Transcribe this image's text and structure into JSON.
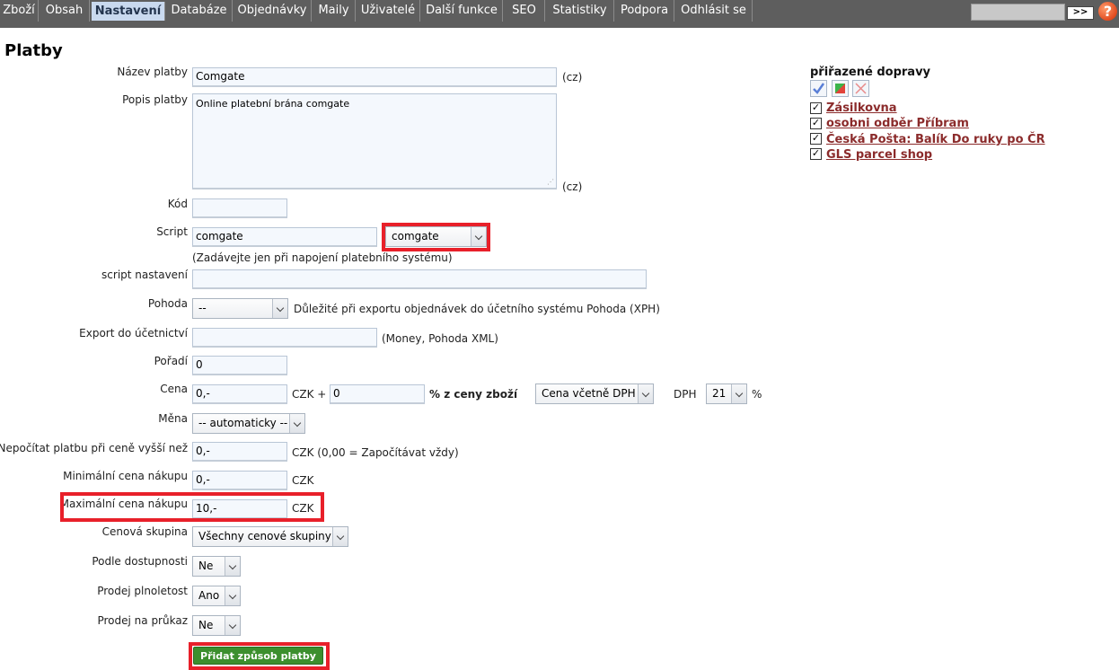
{
  "nav": {
    "items": [
      "Zboží",
      "Obsah",
      "Nastavení",
      "Databáze",
      "Objednávky",
      "Maily",
      "Uživatelé",
      "Další funkce",
      "SEO",
      "Statistiky",
      "Podpora",
      "Odhlásit se"
    ],
    "active": "Nastavení",
    "go_label": ">>",
    "help_label": "?"
  },
  "page": {
    "title": "Platby"
  },
  "form": {
    "nazev": {
      "label": "Název platby",
      "value": "Comgate",
      "suffix": "(cz)"
    },
    "popis": {
      "label": "Popis platby",
      "value": "Online platební brána comgate",
      "suffix": "(cz)"
    },
    "kod": {
      "label": "Kód",
      "value": ""
    },
    "script": {
      "label": "Script",
      "value": "comgate",
      "select": "comgate",
      "hint": "(Zadávejte jen při napojení platebního systému)"
    },
    "script_nastaveni": {
      "label": "script nastavení",
      "value": ""
    },
    "pohoda": {
      "label": "Pohoda",
      "select": "--",
      "hint": "Důležité při exportu objednávek do účetního systému Pohoda (XPH)"
    },
    "export": {
      "label": "Export do účetnictví",
      "value": "",
      "hint": "(Money, Pohoda XML)"
    },
    "poradi": {
      "label": "Pořadí",
      "value": "0"
    },
    "cena": {
      "label": "Cena",
      "value": "0,-",
      "currency_plus": "CZK +",
      "percent": "0",
      "percent_label": "% z ceny zboží",
      "price_type": "Cena včetně DPH",
      "dph_label": "DPH",
      "dph": "21",
      "dph_unit": "%"
    },
    "mena": {
      "label": "Měna",
      "select": "-- automaticky --"
    },
    "nepocitat": {
      "label": "Nepočítat platbu při ceně vyšší než",
      "value": "0,-",
      "hint": "CZK (0,00 = Započítávat vždy)"
    },
    "min_cena": {
      "label": "Minimální cena nákupu",
      "value": "0,-",
      "unit": "CZK"
    },
    "max_cena": {
      "label": "Maximální cena nákupu",
      "value": "10,-",
      "unit": "CZK"
    },
    "cenova_skupina": {
      "label": "Cenová skupina",
      "select": "Všechny cenové skupiny"
    },
    "dostupnost": {
      "label": "Podle dostupnosti",
      "select": "Ne"
    },
    "plnoletost": {
      "label": "Prodej plnoletost",
      "select": "Ano"
    },
    "prukaz": {
      "label": "Prodej na průkaz",
      "select": "Ne"
    },
    "submit_label": "Přidat způsob platby"
  },
  "shipping": {
    "title": "přiřazené dopravy",
    "items": [
      {
        "label": "Zásilkovna",
        "checked": true
      },
      {
        "label": "osobni odběr Příbram",
        "checked": true
      },
      {
        "label": "Česká Pošta: Balík Do ruky po ČR",
        "checked": true
      },
      {
        "label": "GLS parcel shop",
        "checked": true
      }
    ],
    "check_mark": "✓"
  },
  "colors": {
    "nav_bg": "#5e5e5e",
    "highlight": "#e8202a",
    "button": "#3c8f2e",
    "link": "#8b2b2b"
  }
}
